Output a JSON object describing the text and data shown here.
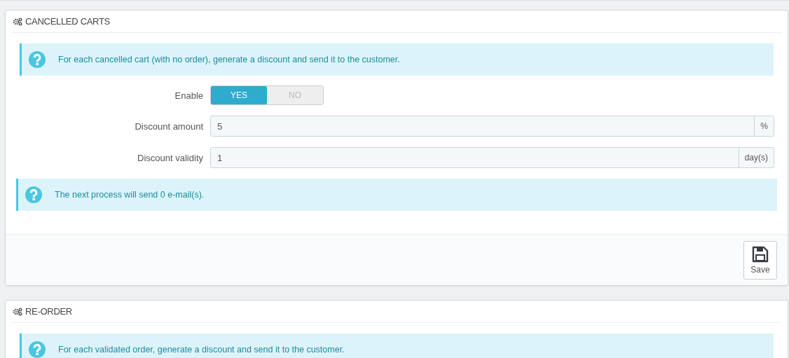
{
  "panels": [
    {
      "title": "CANCELLED CARTS",
      "intro": "For each cancelled cart (with no order), generate a discount and send it to the customer.",
      "fields": [
        {
          "kind": "switch",
          "label": "Enable",
          "options": [
            {
              "label": "YES",
              "selected": true
            },
            {
              "label": "NO",
              "selected": false
            }
          ]
        },
        {
          "kind": "input",
          "label": "Discount amount",
          "value": "5",
          "suffix": "%"
        },
        {
          "kind": "input",
          "label": "Discount validity",
          "value": "1",
          "suffix": "day(s)"
        }
      ],
      "note": "The next process will send 0 e-mail(s).",
      "save_label": "Save"
    },
    {
      "title": "RE-ORDER",
      "intro": "For each validated order, generate a discount and send it to the customer."
    }
  ]
}
